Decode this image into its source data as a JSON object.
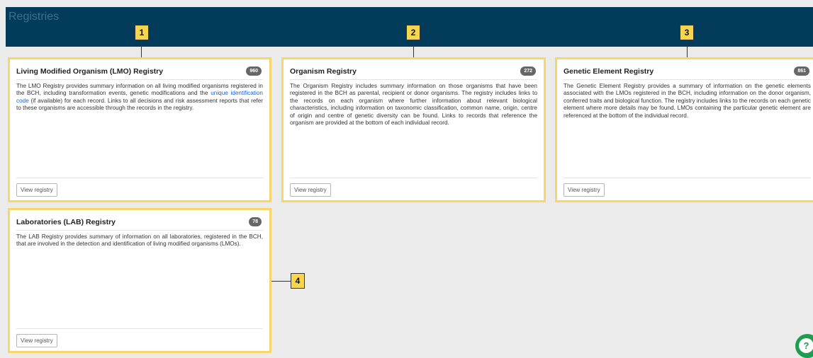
{
  "page": {
    "title": "Registries"
  },
  "callouts": [
    "1",
    "2",
    "3",
    "4"
  ],
  "registries": [
    {
      "title": "Living Modified Organism (LMO) Registry",
      "count": "960",
      "desc_before": "The LMO Registry provides summary information on all living modified organisms registered in the BCH, including transformation events, genetic modifications and the ",
      "link_text": "unique identification code",
      "desc_after": " (if available) for each record. Links to all decisions and risk assessment reports that refer to these organisms are accessible through the records in the registry.",
      "button": "View registry"
    },
    {
      "title": "Organism Registry",
      "count": "272",
      "description": "The Organism Registry includes summary information on those organisms that have been registered in the BCH as parental, recipient or donor organisms. The registry includes links to the records on each organism where further information about relevant biological characteristics, including information on taxonomic classification, common name, origin, centre of origin and centre of genetic diversity can be found. Links to records that reference the organism are provided at the bottom of each individual record.",
      "button": "View registry"
    },
    {
      "title": "Genetic Element Registry",
      "count": "861",
      "description": "The Genetic Element Registry provides a summary of information on the genetic elements associated with the LMOs registered in the BCH, including information on the donor organism, conferred traits and biological function. The registry includes links to the records on each genetic element where more details may be found. LMOs containing the particular genetic element are referenced at the bottom of the individual record.",
      "button": "View registry"
    },
    {
      "title": "Laboratories (LAB) Registry",
      "count": "78",
      "description": "The LAB Registry provides summary of information on all laboratories, registered in the BCH, that are involved in the detection and identification of living modified organisms (LMOs).",
      "button": "View registry"
    }
  ],
  "help": {
    "icon": "help-icon",
    "symbol": "?"
  }
}
